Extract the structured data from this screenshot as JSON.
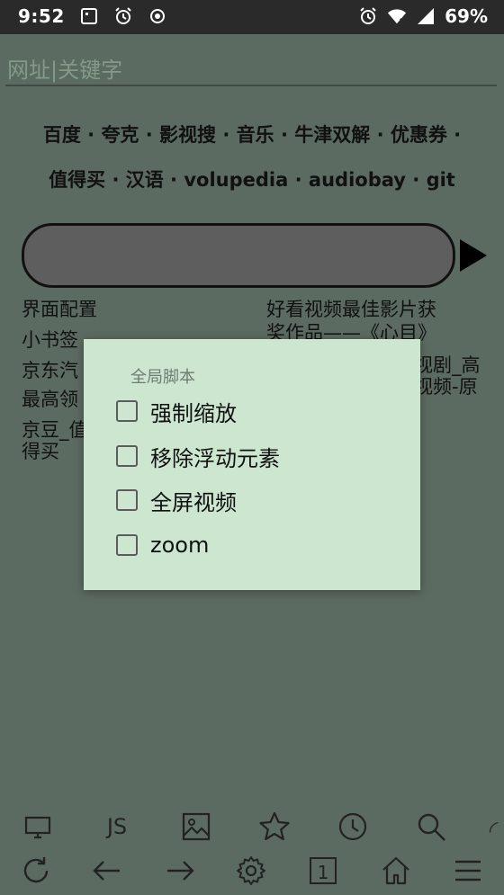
{
  "status": {
    "time": "9:52",
    "battery": "69%"
  },
  "url": {
    "placeholder": "网址|关键字"
  },
  "quick_links_row1": [
    "百度",
    "夸克",
    "影视搜",
    "音乐",
    "牛津双解",
    "优惠券"
  ],
  "quick_links_row2": [
    "值得买",
    "汉语",
    "volupedia",
    "audiobay",
    "git"
  ],
  "separator": " · ",
  "bookmarks": {
    "left": [
      "界面配置",
      "小书签",
      "京东汽",
      "最高领",
      "京豆_值",
      "得买"
    ],
    "right": [
      "好看视频最佳影片获",
      "奖作品——《心目》",
      "视剧_高",
      "视频-原"
    ]
  },
  "dialog": {
    "title": "全局脚本",
    "options": [
      "强制缩放",
      "移除浮动元素",
      "全屏视频",
      "zoom"
    ]
  },
  "toolbar_top": {
    "js_label": "JS",
    "icons": [
      "desktop-icon",
      "js-icon",
      "image-icon",
      "star-icon",
      "clock-icon",
      "search-icon",
      "partial-icon"
    ]
  },
  "toolbar_bottom": {
    "tab_count": "1",
    "icons": [
      "reload-icon",
      "back-icon",
      "forward-icon",
      "gear-icon",
      "tabs-icon",
      "home-icon",
      "menu-icon"
    ]
  },
  "colors": {
    "app_bg": "#5c6b61",
    "dialog_bg": "#cce6d0",
    "statusbar_bg": "#2a2a2a"
  }
}
